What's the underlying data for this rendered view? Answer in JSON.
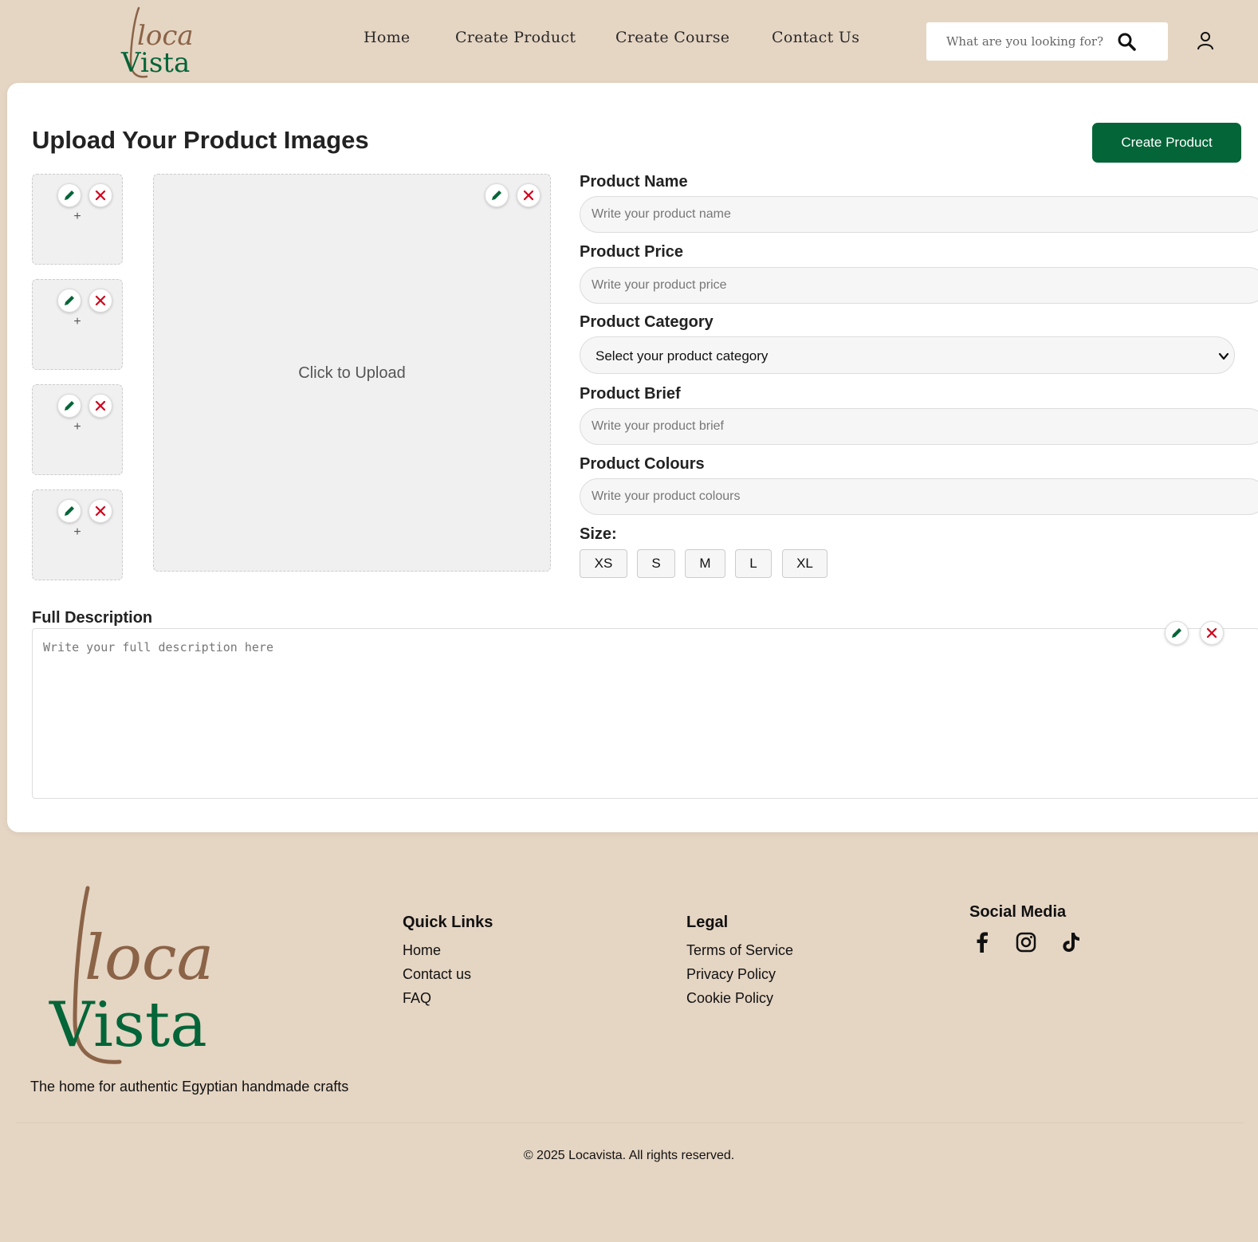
{
  "header": {
    "logo_text_top": "loca",
    "logo_text_bottom": "Vista",
    "nav": [
      {
        "label": "Home"
      },
      {
        "label": "Create Product"
      },
      {
        "label": "Create Course"
      },
      {
        "label": "Contact Us"
      }
    ],
    "search_placeholder": "What are you looking for?"
  },
  "main": {
    "title": "Upload Your Product Images",
    "create_button": "Create Product",
    "thumb_plus": "+",
    "upload_text": "Click to Upload",
    "fields": {
      "name_label": "Product Name",
      "name_placeholder": "Write your product name",
      "price_label": "Product Price",
      "price_placeholder": "Write your product price",
      "category_label": "Product Category",
      "category_selected": "Select your product category",
      "brief_label": "Product Brief",
      "brief_placeholder": "Write your product brief",
      "colours_label": "Product Colours",
      "colours_placeholder": "Write your product colours",
      "size_label": "Size:",
      "sizes": [
        "XS",
        "S",
        "M",
        "L",
        "XL"
      ]
    },
    "description_label": "Full Description",
    "description_placeholder": "Write your full description here"
  },
  "footer": {
    "logo_text_top": "loca",
    "logo_text_bottom": "Vista",
    "tagline": "The home for authentic Egyptian handmade crafts",
    "quick_links_title": "Quick Links",
    "quick_links": [
      "Home",
      "Contact us",
      "FAQ"
    ],
    "legal_title": "Legal",
    "legal_links": [
      "Terms of Service",
      "Privacy Policy",
      "Cookie Policy"
    ],
    "social_title": "Social Media",
    "copyright": "© 2025 Locavista. All rights reserved."
  },
  "colors": {
    "background": "#e5d5c3",
    "brand_green": "#036538",
    "brand_brown": "#8b6347",
    "delete_red": "#d0021b"
  },
  "icons": [
    "search-icon",
    "user-icon",
    "pencil-icon",
    "close-icon",
    "chevron-down-icon",
    "facebook-icon",
    "instagram-icon",
    "tiktok-icon"
  ]
}
